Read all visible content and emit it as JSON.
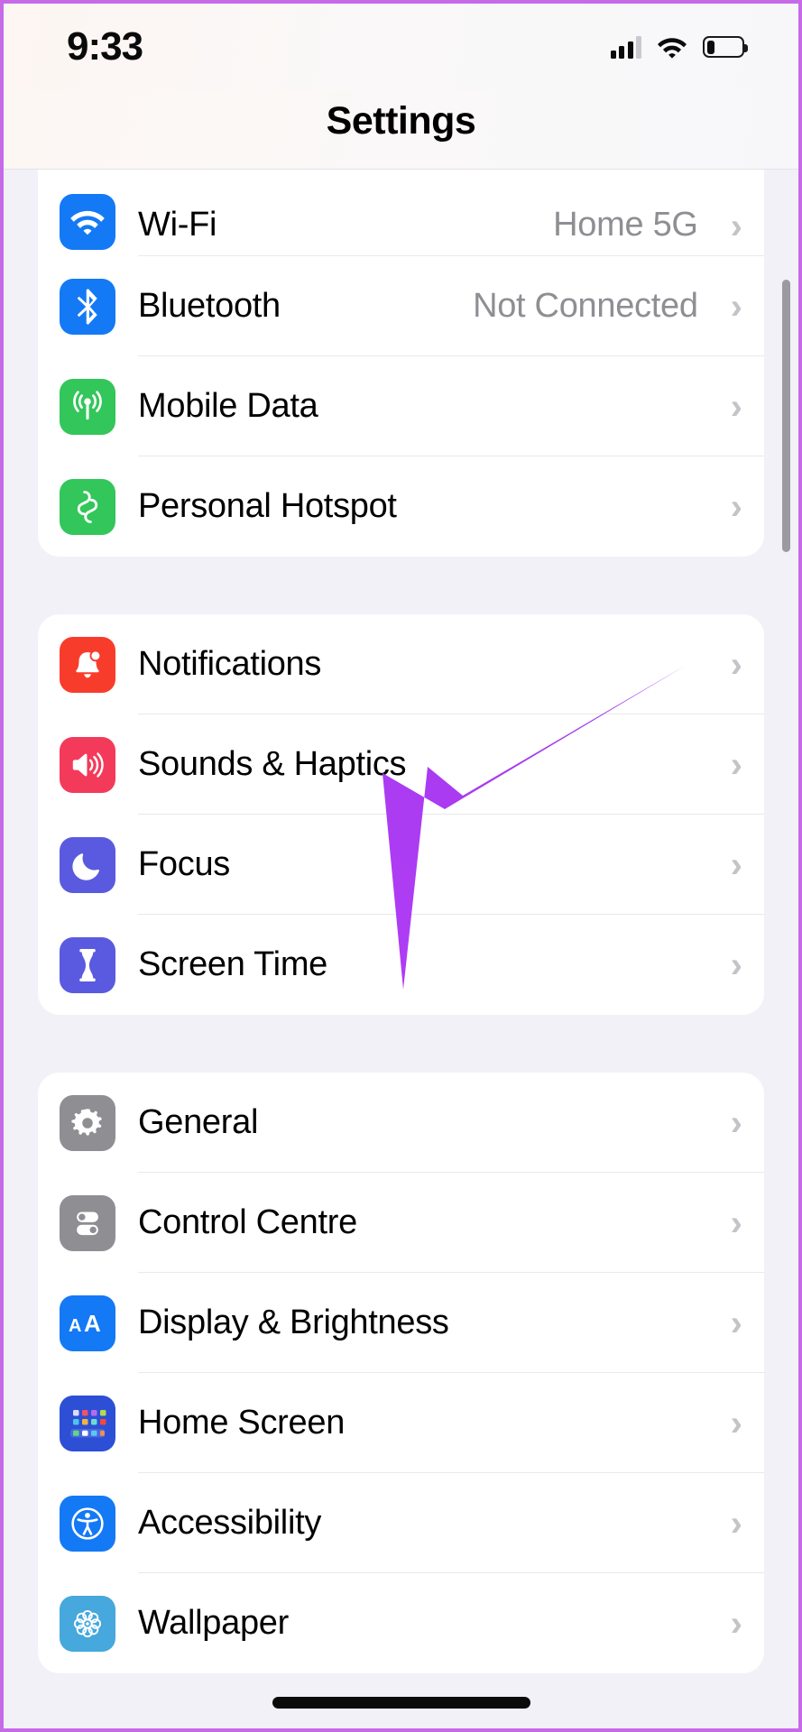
{
  "status_bar": {
    "time": "9:33",
    "signal_icon": "cellular-bars-icon",
    "signal_bars_filled": 3,
    "signal_bars_total": 4,
    "wifi_icon": "wifi-icon",
    "battery_icon": "battery-low-icon",
    "battery_percent": 22
  },
  "nav": {
    "title": "Settings"
  },
  "groups": [
    {
      "name": "connectivity",
      "rows": [
        {
          "label": "Wi-Fi",
          "value": "Home 5G",
          "icon": "wifi-icon",
          "icon_bg": "#1479f5",
          "clipped": true
        },
        {
          "label": "Bluetooth",
          "value": "Not Connected",
          "icon": "bluetooth-icon",
          "icon_bg": "#1479f5",
          "clipped": false
        },
        {
          "label": "Mobile Data",
          "value": "",
          "icon": "cellular-tower-icon",
          "icon_bg": "#33c65a",
          "clipped": false
        },
        {
          "label": "Personal Hotspot",
          "value": "",
          "icon": "hotspot-link-icon",
          "icon_bg": "#33c65a",
          "clipped": false
        }
      ]
    },
    {
      "name": "alerts-and-time",
      "rows": [
        {
          "label": "Notifications",
          "value": "",
          "icon": "bell-icon",
          "icon_bg": "#f83c2c",
          "clipped": false
        },
        {
          "label": "Sounds & Haptics",
          "value": "",
          "icon": "speaker-icon",
          "icon_bg": "#f43a5a",
          "clipped": false
        },
        {
          "label": "Focus",
          "value": "",
          "icon": "moon-icon",
          "icon_bg": "#5a5ae0",
          "clipped": false
        },
        {
          "label": "Screen Time",
          "value": "",
          "icon": "hourglass-icon",
          "icon_bg": "#5a5ae0",
          "clipped": false
        }
      ]
    },
    {
      "name": "system",
      "rows": [
        {
          "label": "General",
          "value": "",
          "icon": "gear-icon",
          "icon_bg": "#8e8e93",
          "clipped": false
        },
        {
          "label": "Control Centre",
          "value": "",
          "icon": "toggles-icon",
          "icon_bg": "#8e8e93",
          "clipped": false
        },
        {
          "label": "Display & Brightness",
          "value": "",
          "icon": "text-size-aa-icon",
          "icon_bg": "#1479f5",
          "clipped": false
        },
        {
          "label": "Home Screen",
          "value": "",
          "icon": "app-grid-icon",
          "icon_bg": "#2d4fd6",
          "clipped": false
        },
        {
          "label": "Accessibility",
          "value": "",
          "icon": "accessibility-icon",
          "icon_bg": "#1479f5",
          "clipped": false
        },
        {
          "label": "Wallpaper",
          "value": "",
          "icon": "flower-icon",
          "icon_bg": "#46a8dc",
          "clipped": false
        }
      ]
    }
  ],
  "annotation": {
    "arrow_icon": "annotation-arrow-icon",
    "color": "#a83bf0",
    "points_at": "Screen Time"
  },
  "chevron_glyph": "›",
  "home_indicator": "home-indicator"
}
